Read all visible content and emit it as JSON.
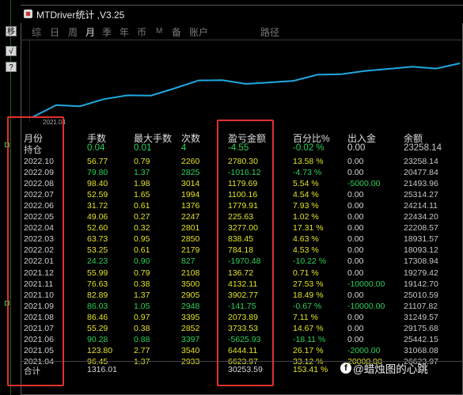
{
  "window": {
    "title": "MTDriver统计 ,V3.25"
  },
  "side_buttons": [
    "移",
    "√",
    "?"
  ],
  "tabs": [
    "综",
    "日",
    "周",
    "月",
    "季",
    "年",
    "币",
    "M",
    "备",
    "账户",
    "路径"
  ],
  "active_tab_index": 3,
  "chart": {
    "type": "line",
    "start_label": "2021.04",
    "line_color": "#1fa8df"
  },
  "chart_data": {
    "type": "line",
    "x": [
      "2021.04",
      "2021.05",
      "2021.06",
      "2021.07",
      "2021.08",
      "2021.09",
      "2021.10",
      "2021.11",
      "2021.12",
      "2022.01",
      "2022.02",
      "2022.03",
      "2022.04",
      "2022.05",
      "2022.06",
      "2022.07",
      "2022.08",
      "2022.09",
      "2022.10"
    ],
    "y": [
      6623.97,
      13068.08,
      12442.15,
      16175.68,
      18249.57,
      18107.82,
      22010.59,
      26142.7,
      26279.42,
      24308.94,
      25093.12,
      25931.57,
      29208.57,
      29434.2,
      31214.11,
      32314.27,
      33494.14,
      32477.98,
      35258.28
    ],
    "xlabel": "",
    "ylabel": ""
  },
  "headers": [
    "月份",
    "手数",
    "最大手数",
    "次数",
    "盈亏金额",
    "百分比%",
    "出入金",
    "余额"
  ],
  "holding": {
    "label": "持仓",
    "lots": "0.04",
    "max_lots": "0.01",
    "count": "4",
    "pnl": "-4.55",
    "pct": "-0.02 %",
    "flow": "0.00",
    "balance": "23258.14"
  },
  "rows": [
    {
      "month": "2022.10",
      "lots": "56.77",
      "max_lots": "0.79",
      "count": "2260",
      "pnl": "2780.30",
      "pct": "13.58 %",
      "flow": "0.00",
      "balance": "23258.14"
    },
    {
      "month": "2022.09",
      "lots": "79.80",
      "max_lots": "1.37",
      "count": "2825",
      "pnl": "-1016.12",
      "pct": "-4.73 %",
      "flow": "0.00",
      "balance": "20477.84"
    },
    {
      "month": "2022.08",
      "lots": "98.40",
      "max_lots": "1.98",
      "count": "3014",
      "pnl": "1179.69",
      "pct": "5.54 %",
      "flow": "-5000.00",
      "balance": "21493.96"
    },
    {
      "month": "2022.07",
      "lots": "52.59",
      "max_lots": "1.65",
      "count": "1994",
      "pnl": "1100.16",
      "pct": "4.54 %",
      "flow": "0.00",
      "balance": "25314.27"
    },
    {
      "month": "2022.06",
      "lots": "31.72",
      "max_lots": "0.61",
      "count": "1376",
      "pnl": "1779.91",
      "pct": "7.93 %",
      "flow": "0.00",
      "balance": "24214.11"
    },
    {
      "month": "2022.05",
      "lots": "49.06",
      "max_lots": "0.27",
      "count": "2247",
      "pnl": "225.63",
      "pct": "1.02 %",
      "flow": "0.00",
      "balance": "22434.20"
    },
    {
      "month": "2022.04",
      "lots": "52.60",
      "max_lots": "0.32",
      "count": "2801",
      "pnl": "3277.00",
      "pct": "17.31 %",
      "flow": "0.00",
      "balance": "22208.57"
    },
    {
      "month": "2022.03",
      "lots": "63.73",
      "max_lots": "0.95",
      "count": "2850",
      "pnl": "838.45",
      "pct": "4.63 %",
      "flow": "0.00",
      "balance": "18931.57"
    },
    {
      "month": "2022.02",
      "lots": "53.25",
      "max_lots": "0.61",
      "count": "2179",
      "pnl": "784.18",
      "pct": "4.53 %",
      "flow": "0.00",
      "balance": "18093.12"
    },
    {
      "month": "2022.01",
      "lots": "24.23",
      "max_lots": "0.90",
      "count": "827",
      "pnl": "-1970.48",
      "pct": "-10.22 %",
      "flow": "0.00",
      "balance": "17308.94"
    },
    {
      "month": "2021.12",
      "lots": "55.99",
      "max_lots": "0.79",
      "count": "2108",
      "pnl": "136.72",
      "pct": "0.71 %",
      "flow": "0.00",
      "balance": "19279.42"
    },
    {
      "month": "2021.11",
      "lots": "76.63",
      "max_lots": "0.38",
      "count": "3500",
      "pnl": "4132.11",
      "pct": "27.53 %",
      "flow": "-10000.00",
      "balance": "19142.70"
    },
    {
      "month": "2021.10",
      "lots": "82.89",
      "max_lots": "1.37",
      "count": "2905",
      "pnl": "3902.77",
      "pct": "18.49 %",
      "flow": "0.00",
      "balance": "25010.59"
    },
    {
      "month": "2021.09",
      "lots": "86.03",
      "max_lots": "1.05",
      "count": "2948",
      "pnl": "-141.75",
      "pct": "-0.67 %",
      "flow": "-10000.00",
      "balance": "21107.82"
    },
    {
      "month": "2021.08",
      "lots": "86.46",
      "max_lots": "0.97",
      "count": "3395",
      "pnl": "2073.89",
      "pct": "7.11 %",
      "flow": "0.00",
      "balance": "31249.57"
    },
    {
      "month": "2021.07",
      "lots": "55.29",
      "max_lots": "0.38",
      "count": "2852",
      "pnl": "3733.53",
      "pct": "14.67 %",
      "flow": "0.00",
      "balance": "29175.68"
    },
    {
      "month": "2021.06",
      "lots": "90.28",
      "max_lots": "0.88",
      "count": "3397",
      "pnl": "-5625.93",
      "pct": "-18.11 %",
      "flow": "0.00",
      "balance": "25442.15"
    },
    {
      "month": "2021.05",
      "lots": "123.80",
      "max_lots": "2.77",
      "count": "3540",
      "pnl": "6444.11",
      "pct": "26.17 %",
      "flow": "-2000.00",
      "balance": "31068.08"
    },
    {
      "month": "2021.04",
      "lots": "96.45",
      "max_lots": "1.37",
      "count": "2933",
      "pnl": "6623.97",
      "pct": "33.12 %",
      "flow": "20000.00",
      "balance": "26623.97"
    }
  ],
  "total": {
    "label": "合计",
    "lots": "1316.01",
    "pnl": "30253.59",
    "pct": "153.41 %"
  },
  "watermark": {
    "logo": "f",
    "text": "@蜡烛图的心跳"
  },
  "colors": {
    "positive": "#e3e32a",
    "negative": "#2ed05a",
    "highlight_box": "#e0322b",
    "chart_line": "#1fa8df"
  }
}
